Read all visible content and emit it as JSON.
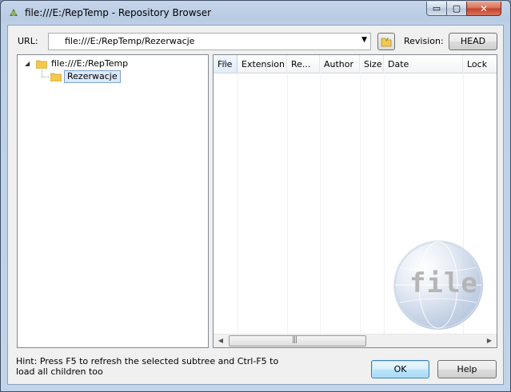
{
  "window": {
    "title": "file:///E:/RepTemp - Repository Browser",
    "controls": {
      "minimize": "▭",
      "maximize": "▢",
      "close": "✕"
    }
  },
  "toolbar": {
    "url_label": "URL:",
    "url_value": "file:///E:/RepTemp/Rezerwacje",
    "revision_label": "Revision:",
    "revision_button": "HEAD"
  },
  "tree": {
    "root_label": "file:///E:/RepTemp",
    "child_label": "Rezerwacje"
  },
  "list": {
    "columns": [
      "File",
      "Extension",
      "Re...",
      "Author",
      "Size",
      "Date",
      "Lock"
    ],
    "rows": [],
    "watermark": "file"
  },
  "footer": {
    "hint": "Hint: Press F5 to refresh the selected subtree and Ctrl-F5 to load all children too",
    "ok_label": "OK",
    "help_label": "Help"
  },
  "colors": {
    "frame": "#c2d4ea",
    "client": "#f0f0f0",
    "selection": "#dbe9fb",
    "folder": "#f2c94c"
  },
  "icons": {
    "app": "tortoise-svn-icon",
    "folder": "folder-icon",
    "browse": "folder-open-icon"
  }
}
